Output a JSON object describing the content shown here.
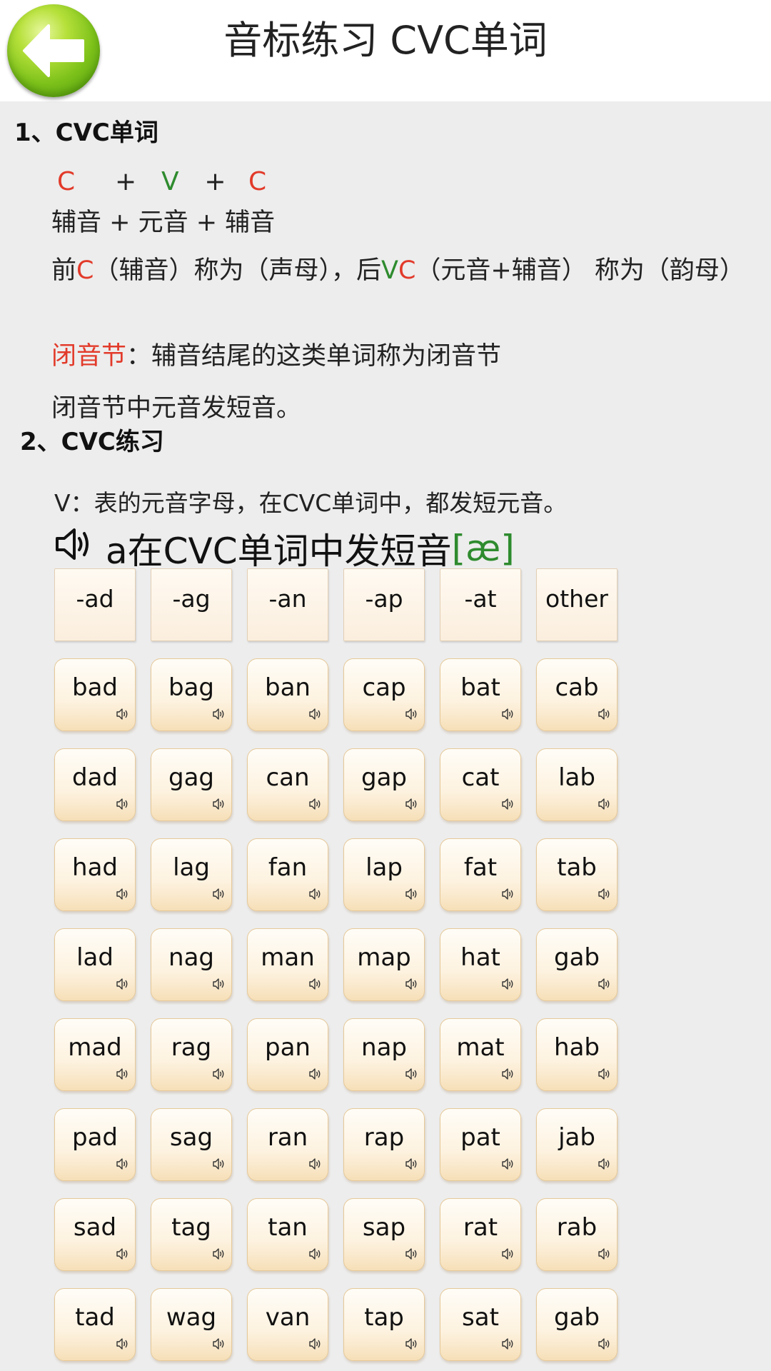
{
  "header": {
    "title": "音标练习 CVC单词",
    "back_icon": "back-arrow-icon"
  },
  "section1": {
    "title": "1、CVC单词",
    "formula": {
      "c1": "C",
      "plus1": "+",
      "v": "V",
      "plus2": "+",
      "c2": "C"
    },
    "formula_desc": "辅音 + 元音 + 辅音",
    "line1": {
      "p1": "前",
      "c": "C",
      "p2": "（辅音）称为（声母），后",
      "v": "V",
      "c2": "C",
      "p3": "（元音+辅音） 称为（韵母）"
    },
    "closed_label": "闭音节",
    "closed_desc": "：辅音结尾的这类单词称为闭音节",
    "closed_note": "闭音节中元音发短音。"
  },
  "section2": {
    "title": "2、CVC练习",
    "v_note": "V：表的元音字母，在CVC单词中，都发短元音。",
    "sound_heading": "a在CVC单词中发短音",
    "phonetic": "[æ]",
    "columns": [
      "-ad",
      "-ag",
      "-an",
      "-ap",
      "-at",
      "other"
    ],
    "rows": [
      [
        "bad",
        "bag",
        "ban",
        "cap",
        "bat",
        "cab"
      ],
      [
        "dad",
        "gag",
        "can",
        "gap",
        "cat",
        "lab"
      ],
      [
        "had",
        "lag",
        "fan",
        "lap",
        "fat",
        "tab"
      ],
      [
        "lad",
        "nag",
        "man",
        "map",
        "hat",
        "gab"
      ],
      [
        "mad",
        "rag",
        "pan",
        "nap",
        "mat",
        "hab"
      ],
      [
        "pad",
        "sag",
        "ran",
        "rap",
        "pat",
        "jab"
      ],
      [
        "sad",
        "tag",
        "tan",
        "sap",
        "rat",
        "rab"
      ],
      [
        "tad",
        "wag",
        "van",
        "tap",
        "sat",
        "gab"
      ]
    ]
  },
  "colors": {
    "accent_red": "#e23a2a",
    "accent_green": "#2e8b2e",
    "back_button": "#7cc11a",
    "cell_bg": "#fdf2df"
  }
}
